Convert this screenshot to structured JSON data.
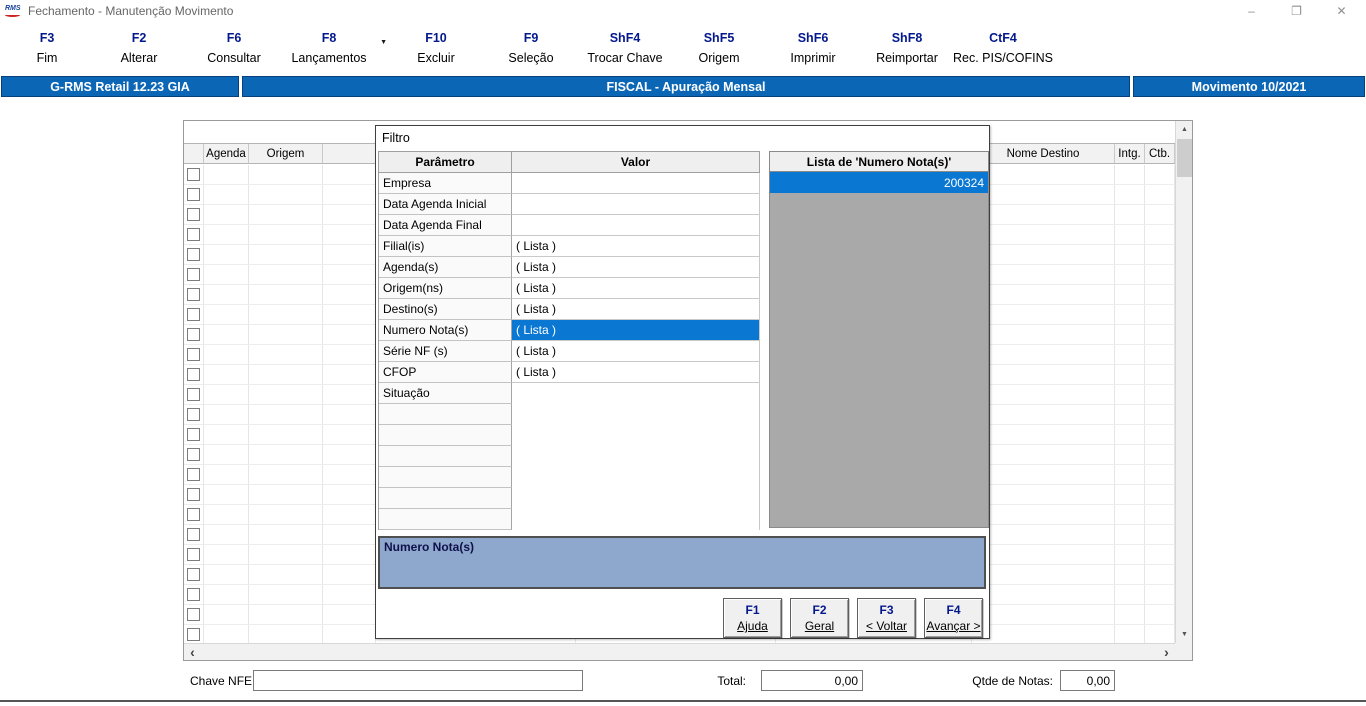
{
  "window": {
    "title": "Fechamento - Manutenção Movimento",
    "minimize": "–",
    "maximize": "❐",
    "close": "✕"
  },
  "toolbar": {
    "items": [
      {
        "key": "F3",
        "label": "Fim"
      },
      {
        "key": "F2",
        "label": "Alterar"
      },
      {
        "key": "F6",
        "label": "Consultar"
      },
      {
        "key": "F8",
        "label": "Lançamentos",
        "dropdown": true
      },
      {
        "key": "F10",
        "label": "Excluir"
      },
      {
        "key": "F9",
        "label": "Seleção"
      },
      {
        "key": "ShF4",
        "label": "Trocar Chave"
      },
      {
        "key": "ShF5",
        "label": "Origem"
      },
      {
        "key": "ShF6",
        "label": "Imprimir"
      },
      {
        "key": "ShF8",
        "label": "Reimportar"
      },
      {
        "key": "CtF4",
        "label": "Rec. PIS/COFINS"
      }
    ]
  },
  "header_bar": {
    "left": "G-RMS Retail 12.23 GIA",
    "center": "FISCAL - Apuração Mensal",
    "right": "Movimento 10/2021",
    "bg_color": "#0c66b6"
  },
  "grid": {
    "headers": [
      "",
      "Agenda",
      "Origem",
      "",
      "",
      "",
      "",
      "Nome Destino",
      "Intg.",
      "Ctb."
    ],
    "row_count": 24
  },
  "filter_dialog": {
    "title": "Filtro",
    "columns": {
      "param": "Parâmetro",
      "value": "Valor"
    },
    "rows": [
      {
        "param": "Empresa",
        "value": ""
      },
      {
        "param": "Data Agenda Inicial",
        "value": ""
      },
      {
        "param": "Data Agenda Final",
        "value": ""
      },
      {
        "param": "Filial(is)",
        "value": "( Lista )"
      },
      {
        "param": "Agenda(s)",
        "value": "( Lista )"
      },
      {
        "param": "Origem(ns)",
        "value": "( Lista )"
      },
      {
        "param": "Destino(s)",
        "value": "( Lista )"
      },
      {
        "param": "Numero Nota(s)",
        "value": "( Lista )",
        "selected": true
      },
      {
        "param": "Série NF (s)",
        "value": "( Lista )"
      },
      {
        "param": "CFOP",
        "value": "( Lista )"
      },
      {
        "param": "Situação",
        "value": ""
      },
      {
        "param": "",
        "value": ""
      },
      {
        "param": "",
        "value": ""
      },
      {
        "param": "",
        "value": ""
      },
      {
        "param": "",
        "value": ""
      },
      {
        "param": "",
        "value": ""
      },
      {
        "param": "",
        "value": ""
      }
    ],
    "list_panel": {
      "header": "Lista de 'Numero Nota(s)'",
      "items": [
        "200324"
      ],
      "selected_index": 0
    },
    "info_box": "Numero Nota(s)",
    "buttons": [
      {
        "key": "F1",
        "label": "Ajuda"
      },
      {
        "key": "F2",
        "label": "Geral"
      },
      {
        "key": "F3",
        "label": "< Voltar"
      },
      {
        "key": "F4",
        "label": "Avançar >"
      }
    ],
    "selection_color": "#0a78d2"
  },
  "footer": {
    "chave_nfe_label": "Chave NFE:",
    "chave_nfe_value": "",
    "total_label": "Total:",
    "total_value": "0,00",
    "qtde_label": "Qtde de Notas:",
    "qtde_value": "0,00"
  }
}
